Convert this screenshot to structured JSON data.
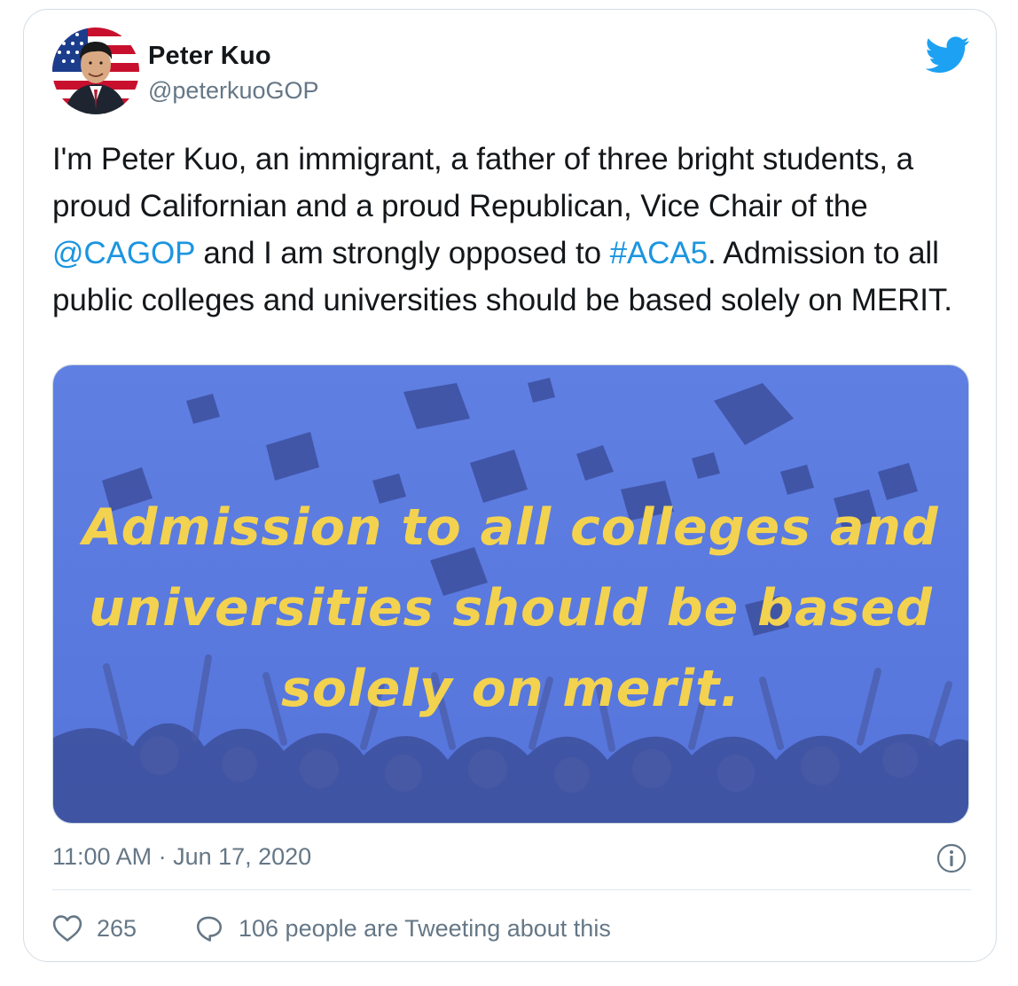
{
  "author": {
    "name": "Peter Kuo",
    "handle": "@peterkuoGOP",
    "avatar_icon": "avatar-photo"
  },
  "tweet": {
    "segments": [
      {
        "text": "I'm Peter Kuo, an immigrant, a father of three bright students, a proud Californian and a proud Republican, Vice Chair of the ",
        "link": false
      },
      {
        "text": "@CAGOP",
        "link": true
      },
      {
        "text": " and I am strongly opposed to ",
        "link": false
      },
      {
        "text": "#ACA5",
        "link": true
      },
      {
        "text": ". Admission to all public colleges and universities should be based solely on MERIT.",
        "link": false
      }
    ]
  },
  "media": {
    "caption_lines": [
      "Admission to all colleges and",
      "universities should be based",
      "solely on merit."
    ],
    "overlay_color": "#5b7be0",
    "caption_color": "#f3d24f"
  },
  "meta": {
    "timestamp": "11:00 AM · Jun 17, 2020"
  },
  "actions": {
    "likes_count": "265",
    "replies_text": "106 people are Tweeting about this"
  },
  "colors": {
    "link": "#1b95e0",
    "muted": "#657786",
    "twitter_blue": "#1da1f2"
  }
}
